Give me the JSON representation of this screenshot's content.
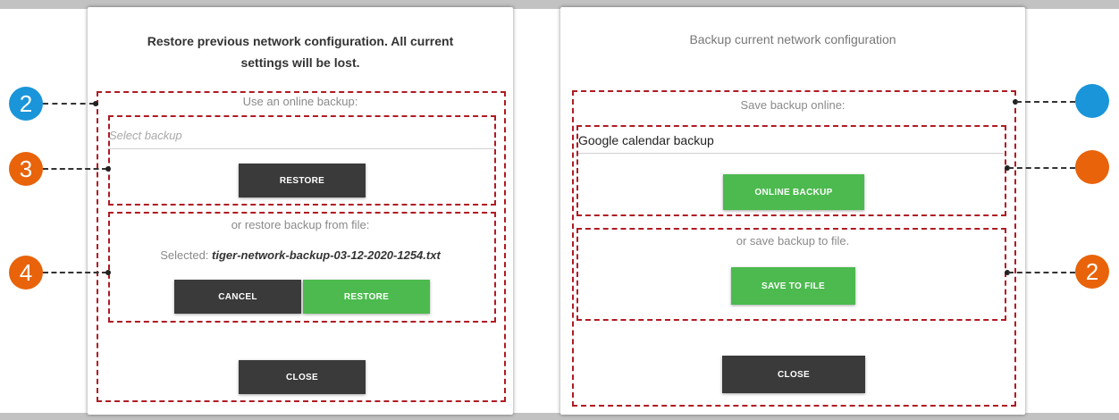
{
  "colors": {
    "annotation_dash": "#b01b24",
    "badge_blue": "#1a95d9",
    "badge_orange": "#e8630a",
    "button_dark": "#3a3a3a",
    "button_green": "#4cba4e"
  },
  "restore_dialog": {
    "title_line1": "Restore previous network configuration. All current",
    "title_line2": "settings will be lost.",
    "online_label": "Use an online backup:",
    "select_placeholder": "Select backup",
    "restore_button": "RESTORE",
    "file_label": "or restore backup from file:",
    "selected_prefix": "Selected:",
    "selected_file": "tiger-network-backup-03-12-2020-1254.txt",
    "cancel_button": "CANCEL",
    "restore_file_button": "RESTORE",
    "close_button": "CLOSE"
  },
  "backup_dialog": {
    "title": "Backup current network configuration",
    "online_label": "Save backup online:",
    "name_value": "Google calendar backup",
    "online_backup_button": "ONLINE BACKUP",
    "file_label": "or save backup to file.",
    "save_file_button": "SAVE TO FILE",
    "close_button": "CLOSE"
  },
  "annotations": {
    "left": [
      "2",
      "3",
      "4"
    ],
    "right": [
      "",
      "",
      "2"
    ]
  }
}
